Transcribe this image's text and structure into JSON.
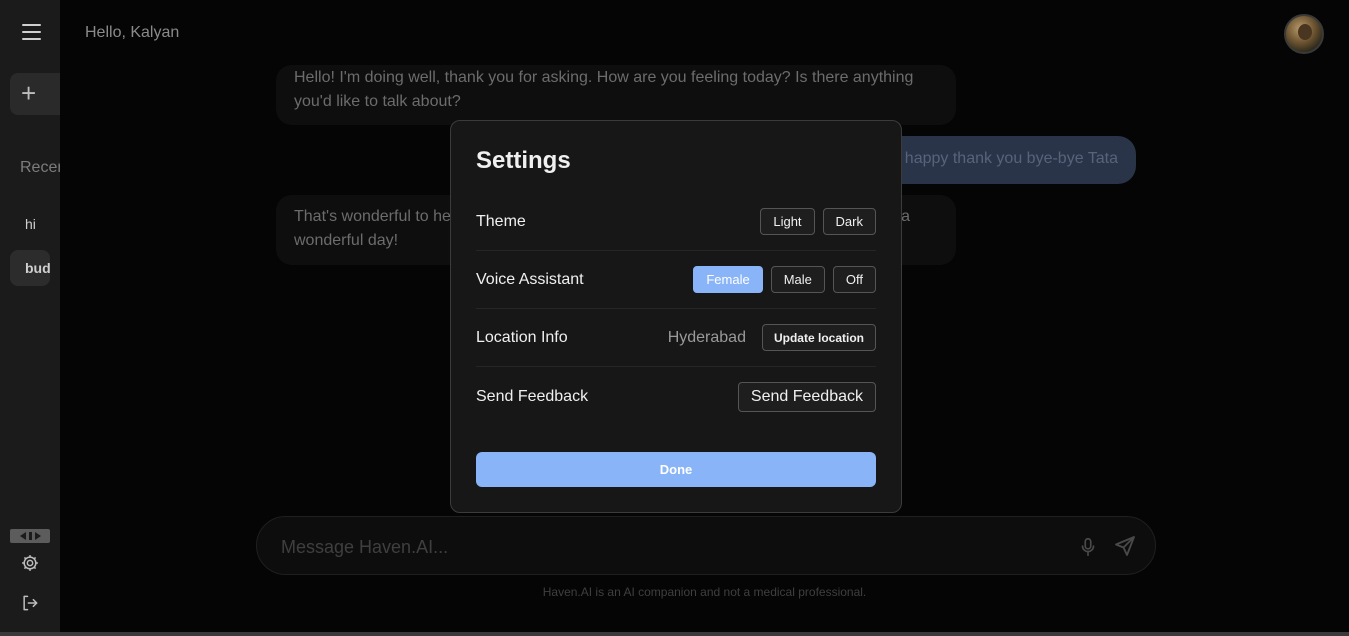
{
  "header": {
    "greeting": "Hello, Kalyan"
  },
  "sidebar": {
    "new_chat_label": "+",
    "recent_label": "Recent",
    "items": [
      {
        "label": "hi"
      },
      {
        "label": "buddy"
      }
    ]
  },
  "conversation": {
    "messages": [
      {
        "role": "ai",
        "text": "Hello! I'm doing well, thank you for asking.  How are you feeling today?  Is there anything you'd like to talk about?"
      },
      {
        "role": "user",
        "text": "I'm happy thank you bye-bye Tata"
      },
      {
        "role": "ai",
        "text": "That's wonderful to hear! I'm glad you're feeling happy. Take care, and bye-bye! Have a wonderful day!"
      }
    ]
  },
  "composer": {
    "placeholder": "Message Haven.AI...",
    "disclaimer": "Haven.AI is an AI companion and not a medical professional."
  },
  "settings": {
    "title": "Settings",
    "theme": {
      "label": "Theme",
      "options": [
        "Light",
        "Dark"
      ]
    },
    "voice": {
      "label": "Voice Assistant",
      "options": [
        "Female",
        "Male",
        "Off"
      ],
      "selected": "Female"
    },
    "location": {
      "label": "Location Info",
      "value": "Hyderabad",
      "button": "Update location"
    },
    "feedback": {
      "label": "Send Feedback",
      "button": "Send Feedback"
    },
    "done_label": "Done"
  },
  "colors": {
    "accent": "#8ab4f8",
    "modal_bg": "#171717",
    "sidebar_bg": "#1b1b1b",
    "user_bubble": "#2a3448"
  }
}
